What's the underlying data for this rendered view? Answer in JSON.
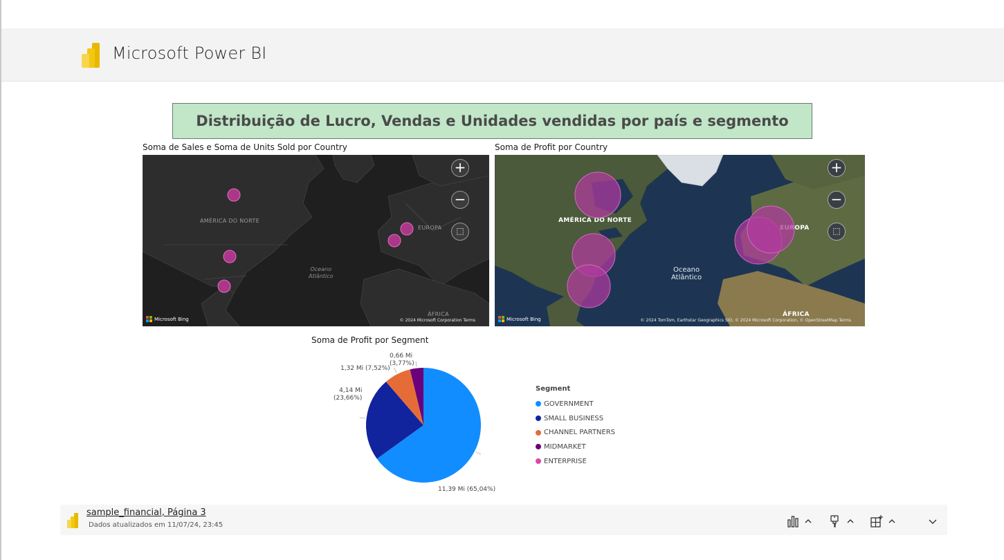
{
  "app": {
    "title": "Microsoft Power BI",
    "logo_icon": "power-bi-logo-icon"
  },
  "report": {
    "title": "Distribuição de Lucro, Vendas e Unidades vendidas por país e segmento",
    "title_bg": "#c1e6c8"
  },
  "map_sales": {
    "title": "Soma de Sales e Soma de Units Sold por Country",
    "labels": {
      "north_america": "AMÉRICA DO NORTE",
      "europe": "EUROPA",
      "ocean_line1": "Oceano",
      "ocean_line2": "Atlântico",
      "africa": "ÁFRICA"
    },
    "attribution": "Microsoft Bing",
    "copyright": "© 2024 Microsoft Corporation  Terms",
    "bubble_color": "#c2399a"
  },
  "map_profit": {
    "title": "Soma de Profit por Country",
    "labels": {
      "north_america": "AMÉRICA DO NORTE",
      "europe": "EUROPA",
      "ocean_line1": "Oceano",
      "ocean_line2": "Atlântico",
      "africa": "ÁFRICA"
    },
    "attribution": "Microsoft Bing",
    "copyright": "© 2024 TomTom, Earthstar Geographics SIO, © 2024 Microsoft Corporation, © OpenStreetMap  Terms",
    "bubble_color": "#b23aa0"
  },
  "pie": {
    "title": "Soma de Profit por Segment",
    "legend_title": "Segment",
    "slices": [
      {
        "name": "GOVERNMENT",
        "value": 11.39,
        "percent": 65.04,
        "label_line1": "11,39 Mi (65,04%)",
        "label_line2": "",
        "color": "#118dff"
      },
      {
        "name": "SMALL BUSINESS",
        "value": 4.14,
        "percent": 23.66,
        "label_line1": "4,14 Mi",
        "label_line2": "(23,66%)",
        "color": "#12239e"
      },
      {
        "name": "CHANNEL PARTNERS",
        "value": 1.32,
        "percent": 7.52,
        "label_line1": "1,32 Mi (7,52%)",
        "label_line2": "",
        "color": "#e66c37"
      },
      {
        "name": "MIDMARKET",
        "value": 0.66,
        "percent": 3.77,
        "label_line1": "0,66 Mi",
        "label_line2": "(3,77%)",
        "color": "#6b007b"
      },
      {
        "name": "ENTERPRISE",
        "value": 0.0,
        "percent": 0.0,
        "label_line1": "",
        "label_line2": "",
        "color": "#e044a7"
      }
    ]
  },
  "footer": {
    "report_name": "sample_financial, Página 3",
    "updated": "Dados atualizados em 11/07/24, 23:45",
    "buttons": [
      {
        "icon": "bar-chart-icon"
      },
      {
        "icon": "paint-brush-icon"
      },
      {
        "icon": "add-visual-icon"
      },
      {
        "icon": "chevron-down-icon"
      }
    ]
  }
}
